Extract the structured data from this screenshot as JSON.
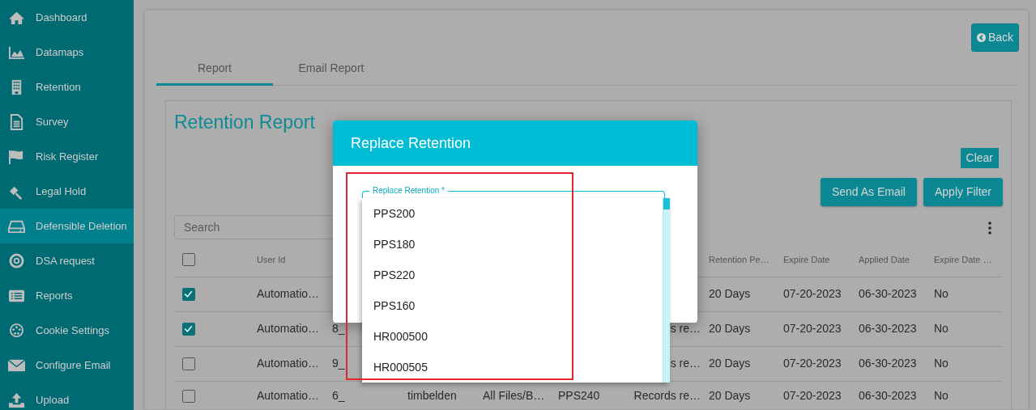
{
  "sidebar": {
    "items": [
      {
        "label": "Dashboard",
        "selected": false
      },
      {
        "label": "Datamaps",
        "selected": false
      },
      {
        "label": "Retention",
        "selected": false
      },
      {
        "label": "Survey",
        "selected": false
      },
      {
        "label": "Risk Register",
        "selected": false
      },
      {
        "label": "Legal Hold",
        "selected": false
      },
      {
        "label": "Defensible Deletion",
        "selected": true
      },
      {
        "label": "DSA request",
        "selected": false
      },
      {
        "label": "Reports",
        "selected": false
      },
      {
        "label": "Cookie Settings",
        "selected": false
      },
      {
        "label": "Configure Email",
        "selected": false
      },
      {
        "label": "Upload",
        "selected": false
      }
    ]
  },
  "back_button": "Back",
  "tabs": [
    {
      "label": "Report",
      "selected": true
    },
    {
      "label": "Email Report",
      "selected": false
    }
  ],
  "report": {
    "title": "Retention Report",
    "clear_button": "Clear",
    "buttons": [
      "Send As Email",
      "Apply Filter"
    ],
    "search": {
      "placeholder": "Search"
    }
  },
  "table": {
    "header_checked": false,
    "columns": [
      "User Id",
      null,
      null,
      null,
      null,
      null,
      "Retention Pe…",
      "Expire Date",
      "Applied Date",
      "Expire Date …"
    ],
    "rows": [
      {
        "selected": true,
        "cells": [
          "Automatio…",
          null,
          null,
          null,
          null,
          null,
          "20 Days",
          "07-20-2023",
          "06-30-2023",
          "No"
        ]
      },
      {
        "selected": true,
        "cells": [
          "Automatio…",
          "8_",
          null,
          null,
          null,
          "s re…",
          "20 Days",
          "07-20-2023",
          "06-30-2023",
          "No"
        ]
      },
      {
        "selected": false,
        "cells": [
          "Automatio…",
          "9_",
          null,
          null,
          null,
          "s re…",
          "20 Days",
          "07-20-2023",
          "06-30-2023",
          "No"
        ]
      },
      {
        "selected": false,
        "cells": [
          "Automatio…",
          "6_",
          "timbelden",
          "All Files/B…",
          "PPS240",
          "Records re…",
          "20 Days",
          "07-20-2023",
          "06-30-2023",
          "No"
        ]
      }
    ]
  },
  "modal": {
    "title": "Replace Retention",
    "field_label": "Replace Retention *",
    "options": [
      "PPS200",
      "PPS180",
      "PPS220",
      "PPS160",
      "HR000500",
      "HR000505"
    ]
  }
}
